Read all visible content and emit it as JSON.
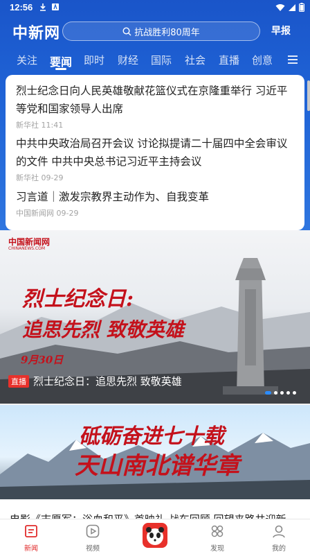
{
  "status_bar": {
    "time": "12:56"
  },
  "header": {
    "logo": "中新网",
    "search_placeholder": "抗战胜利80周年",
    "morning_label": "早报"
  },
  "tabs": [
    "关注",
    "要闻",
    "即时",
    "财经",
    "国际",
    "社会",
    "直播",
    "创意"
  ],
  "active_tab": "要闻",
  "news": [
    {
      "title": "烈士纪念日向人民英雄敬献花篮仪式在京隆重举行 习近平等党和国家领导人出席",
      "source": "新华社",
      "time": "11:41"
    },
    {
      "title": "中共中央政治局召开会议 讨论拟提请二十届四中全会审议的文件 中共中央总书记习近平主持会议",
      "source": "新华社",
      "time": "09-29"
    },
    {
      "title": "习言道｜激发宗教界主动作为、自我变革",
      "source": "中国新闻网",
      "time": "09-29"
    }
  ],
  "banner1": {
    "logo": "中国新闻网",
    "logo_sub": "CHINANEWS.COM",
    "headline_line1": "烈士纪念日:",
    "headline_line2": "追思先烈 致敬英雄",
    "date": "9月30日",
    "badge": "直播",
    "caption": "烈士纪念日：追思先烈 致敬英雄"
  },
  "banner2": {
    "headline_line1": "砥砺奋进七十载",
    "headline_line2": "天山南北谱华章"
  },
  "peek_text": "电影《志愿军：浴血和平》首映礼 战车回顾 回望来路共迎新",
  "bottom_nav": [
    {
      "label": "新闻",
      "icon": "news-icon"
    },
    {
      "label": "视频",
      "icon": "video-icon"
    },
    {
      "label": "",
      "icon": "panda-icon"
    },
    {
      "label": "发现",
      "icon": "discover-icon"
    },
    {
      "label": "我的",
      "icon": "profile-icon"
    }
  ],
  "colors": {
    "brand_blue": "#1f63d6",
    "accent_red": "#e12b2b",
    "morning_badge": "#f5a623"
  }
}
